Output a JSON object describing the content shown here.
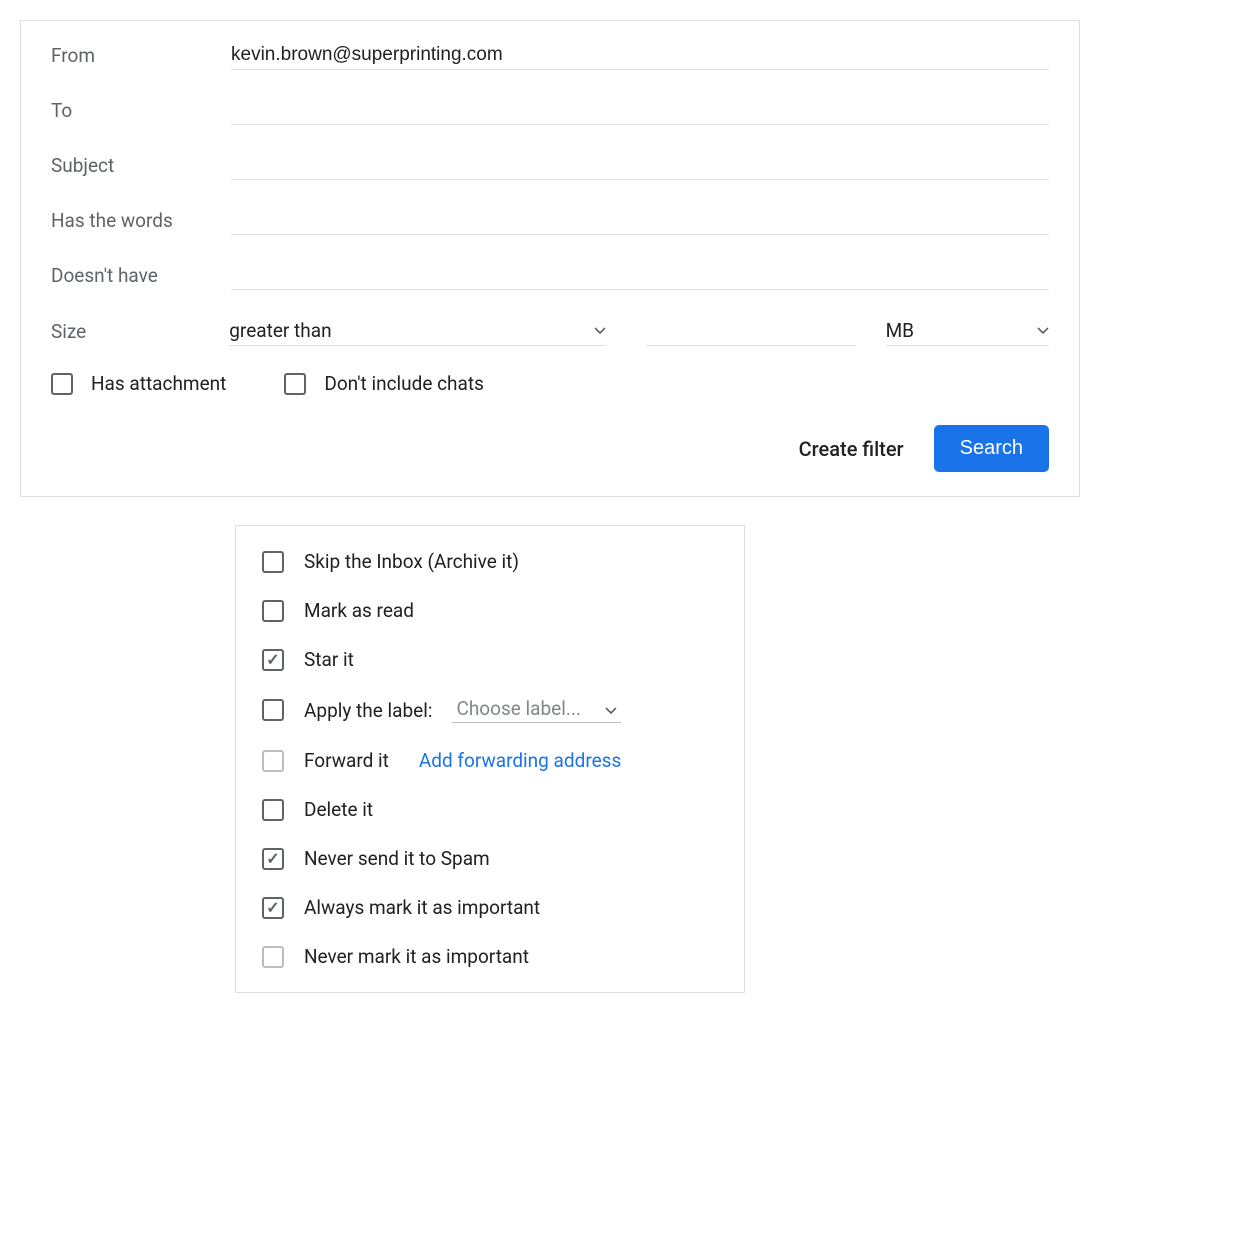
{
  "filterForm": {
    "fromLabel": "From",
    "fromValue": "kevin.brown@superprinting.com",
    "toLabel": "To",
    "toValue": "",
    "subjectLabel": "Subject",
    "subjectValue": "",
    "hasWordsLabel": "Has the words",
    "hasWordsValue": "",
    "doesntHaveLabel": "Doesn't have",
    "doesntHaveValue": "",
    "sizeLabel": "Size",
    "sizeComparator": "greater than",
    "sizeValue": "",
    "sizeUnit": "MB",
    "hasAttachmentLabel": "Has attachment",
    "dontIncludeChatsLabel": "Don't include chats",
    "createFilterLabel": "Create filter",
    "searchLabel": "Search"
  },
  "filterActions": {
    "skip": "Skip the Inbox (Archive it)",
    "markRead": "Mark as read",
    "star": "Star it",
    "applyLabel": "Apply the label:",
    "chooseLabel": "Choose label...",
    "forward": "Forward it",
    "addForwarding": "Add forwarding address",
    "delete": "Delete it",
    "neverSpam": "Never send it to Spam",
    "alwaysImportant": "Always mark it as important",
    "neverImportant": "Never mark it as important"
  }
}
